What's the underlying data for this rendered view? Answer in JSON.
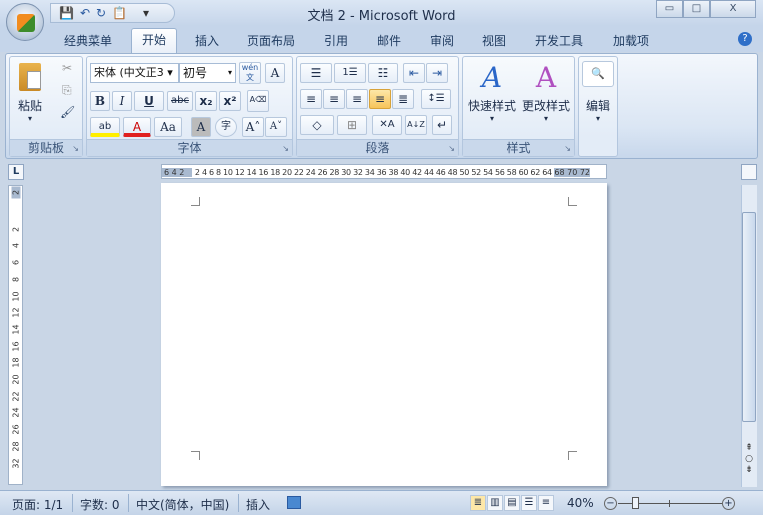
{
  "window": {
    "title": "文档 2 - Microsoft Word",
    "minimize": "▭",
    "maximize": "□",
    "close": "X"
  },
  "qat": {
    "save": "💾",
    "undo": "↶",
    "redo": "↻",
    "paste": "📋",
    "more": "▾"
  },
  "tabs": [
    "经典菜单",
    "开始",
    "插入",
    "页面布局",
    "引用",
    "邮件",
    "审阅",
    "视图",
    "开发工具",
    "加载项"
  ],
  "help": "?",
  "clipboard": {
    "label": "剪贴板",
    "paste": "粘贴",
    "cut": "✂",
    "copy": "⎘",
    "format_painter": "🖌"
  },
  "font": {
    "label": "字体",
    "font_name": "宋体 (中文正3",
    "font_size": "初号",
    "phonetic": "wén 文",
    "border_char": "A",
    "bold": "B",
    "italic": "I",
    "underline": "U",
    "strike": "abc",
    "sub": "x₂",
    "sup": "x²",
    "clear": "A⌫",
    "highlight": "ab",
    "color": "A",
    "case": "Aa",
    "shade": "A",
    "enclose": "字",
    "grow": "A˄",
    "shrink": "A˅"
  },
  "paragraph": {
    "label": "段落",
    "bullets": "☰",
    "numbering": "1☰",
    "multilevel": "☷",
    "dec_indent": "⇤",
    "inc_indent": "⇥",
    "left": "≡",
    "center": "≡",
    "right": "≡",
    "justify": "≡",
    "distributed": "≣",
    "spacing": "↕☰",
    "shading": "◇",
    "borders": "⊞",
    "chinese_layout": "✕A",
    "sort": "A↓Z",
    "marks": "↵"
  },
  "styles": {
    "label": "样式",
    "quick": "快速样式",
    "change": "更改样式"
  },
  "editing": {
    "label": "编辑",
    "find": "🔍"
  },
  "ruler": {
    "tab_selector": "L",
    "left_numbers": "6 4 2",
    "numbers": "2 4 6 8 10 12 14 16 18 20 22 24 26 28 30 32 34 36 38 40 42 44 46 48 50 52 54 56 58 60 62 64",
    "right_numbers": "68 70 72",
    "vertical": [
      "2",
      "2",
      "4",
      "6",
      "8",
      "10",
      "12",
      "14",
      "16",
      "18",
      "20",
      "22",
      "24",
      "26",
      "28",
      "32"
    ]
  },
  "status": {
    "page": "页面: 1/1",
    "words": "字数: 0",
    "language": "中文(简体，中国)",
    "mode": "插入",
    "zoom": "40%",
    "zoom_fraction": 0.4
  }
}
